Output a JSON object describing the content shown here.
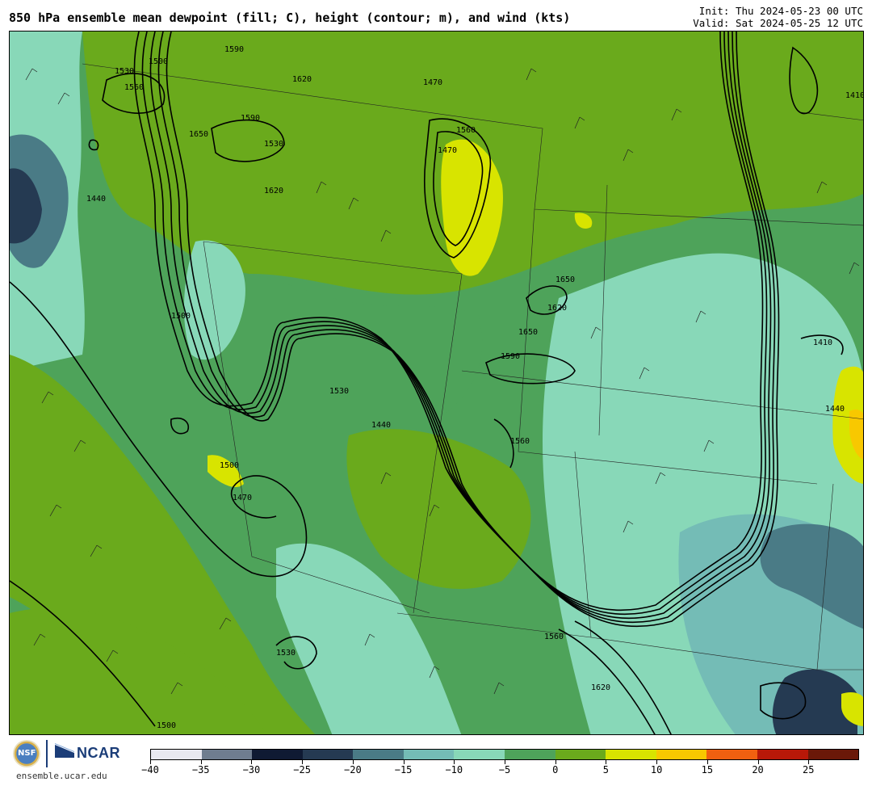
{
  "header": {
    "title": "850 hPa ensemble mean dewpoint (fill; C), height (contour; m), and wind (kts)",
    "init": "Init: Thu 2024-05-23 00 UTC",
    "valid": "Valid: Sat 2024-05-25 12 UTC"
  },
  "footer": {
    "org_nsf": "NSF",
    "org_ncar": "NCAR",
    "site": "ensemble.ucar.edu"
  },
  "colorbar": {
    "colors": [
      "#e8e8f0",
      "#6f7d8f",
      "#0f1a33",
      "#253a52",
      "#4a7b86",
      "#74bcb6",
      "#88d8b8",
      "#4ea35a",
      "#6aaa1c",
      "#d8e400",
      "#f8c800",
      "#f06010",
      "#b81808",
      "#6a1808"
    ],
    "tick_labels": [
      "−40",
      "−35",
      "−30",
      "−25",
      "−20",
      "−15",
      "−10",
      "−5",
      "0",
      "5",
      "10",
      "15",
      "20",
      "25"
    ]
  },
  "contour_labels": [
    "1530",
    "1560",
    "1500",
    "1590",
    "1620",
    "1650",
    "1470",
    "1440",
    "1410",
    "1500",
    "1530",
    "1560",
    "1590",
    "1620",
    "1650",
    "1470",
    "1440",
    "1410",
    "1530",
    "1500",
    "1620",
    "1650",
    "1560",
    "1590",
    "1470",
    "1440",
    "1500",
    "1530",
    "1560",
    "1620"
  ]
}
